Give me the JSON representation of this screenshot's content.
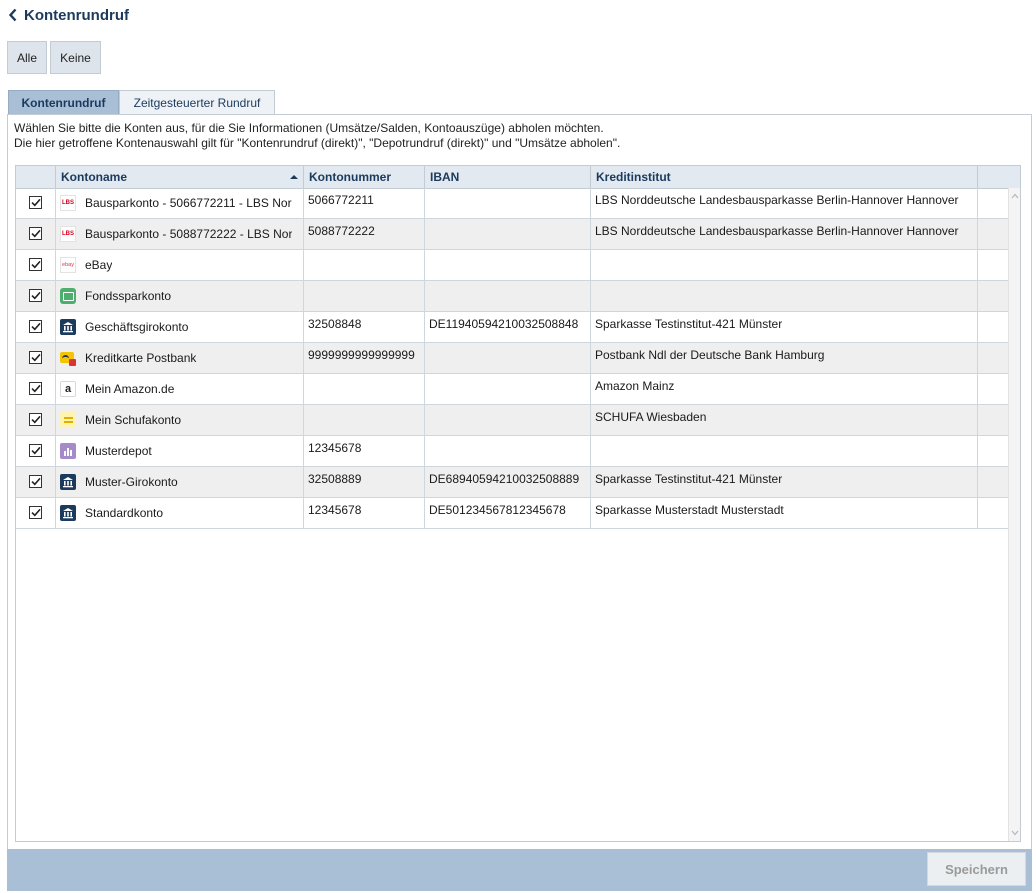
{
  "header": {
    "title": "Kontenrundruf",
    "back_icon": "chevron-left-icon"
  },
  "toolbar": {
    "all_label": "Alle",
    "none_label": "Keine"
  },
  "tabs": [
    {
      "label": "Kontenrundruf",
      "active": true
    },
    {
      "label": "Zeitgesteuerter Rundruf",
      "active": false
    }
  ],
  "description": {
    "line1": "Wählen Sie bitte die Konten aus, für die Sie Informationen (Umsätze/Salden, Kontoauszüge) abholen möchten.",
    "line2": "Die hier getroffene Kontenauswahl gilt für \"Kontenrundruf (direkt)\", \"Depotrundruf (direkt)\" und \"Umsätze abholen\"."
  },
  "table": {
    "columns": [
      "Kontoname",
      "Kontonummer",
      "IBAN",
      "Kreditinstitut"
    ],
    "sort_column": "Kontoname",
    "sort_direction": "ascending",
    "rows": [
      {
        "checked": true,
        "icon": "lbs-icon",
        "name": "Bausparkonto - 5066772211 - LBS Nor",
        "number": "5066772211",
        "iban": "",
        "bank": "LBS Norddeutsche Landesbausparkasse Berlin-Hannover Hannover"
      },
      {
        "checked": true,
        "icon": "lbs-icon",
        "name": "Bausparkonto - 5088772222 - LBS Nor",
        "number": "5088772222",
        "iban": "",
        "bank": "LBS Norddeutsche Landesbausparkasse Berlin-Hannover Hannover"
      },
      {
        "checked": true,
        "icon": "ebay-icon",
        "name": "eBay",
        "number": "",
        "iban": "",
        "bank": ""
      },
      {
        "checked": true,
        "icon": "fund-savings-icon",
        "name": "Fondssparkonto",
        "number": "",
        "iban": "",
        "bank": ""
      },
      {
        "checked": true,
        "icon": "bank-building-icon",
        "name": "Geschäftsgirokonto",
        "number": "32508848",
        "iban": "DE11940594210032508848",
        "bank": "Sparkasse Testinstitut-421 Münster"
      },
      {
        "checked": true,
        "icon": "credit-card-icon",
        "name": "Kreditkarte Postbank",
        "number": "9999999999999999",
        "iban": "",
        "bank": "Postbank Ndl der Deutsche Bank Hamburg"
      },
      {
        "checked": true,
        "icon": "amazon-icon",
        "name": "Mein Amazon.de",
        "number": "",
        "iban": "",
        "bank": "Amazon Mainz"
      },
      {
        "checked": true,
        "icon": "schufa-icon",
        "name": "Mein Schufakonto",
        "number": "",
        "iban": "",
        "bank": "SCHUFA Wiesbaden"
      },
      {
        "checked": true,
        "icon": "depot-chart-icon",
        "name": "Musterdepot",
        "number": "12345678",
        "iban": "",
        "bank": ""
      },
      {
        "checked": true,
        "icon": "bank-building-icon",
        "name": "Muster-Girokonto",
        "number": "32508889",
        "iban": "DE68940594210032508889",
        "bank": "Sparkasse Testinstitut-421 Münster"
      },
      {
        "checked": true,
        "icon": "bank-building-icon",
        "name": "Standardkonto",
        "number": "12345678",
        "iban": "DE501234567812345678",
        "bank": "Sparkasse Musterstadt Musterstadt"
      }
    ]
  },
  "footer": {
    "save_label": "Speichern"
  },
  "colors": {
    "accent": "#a9bfd6",
    "title": "#1b3a5c",
    "header_bg": "#e2e9f1",
    "row_alt": "#efefef"
  }
}
